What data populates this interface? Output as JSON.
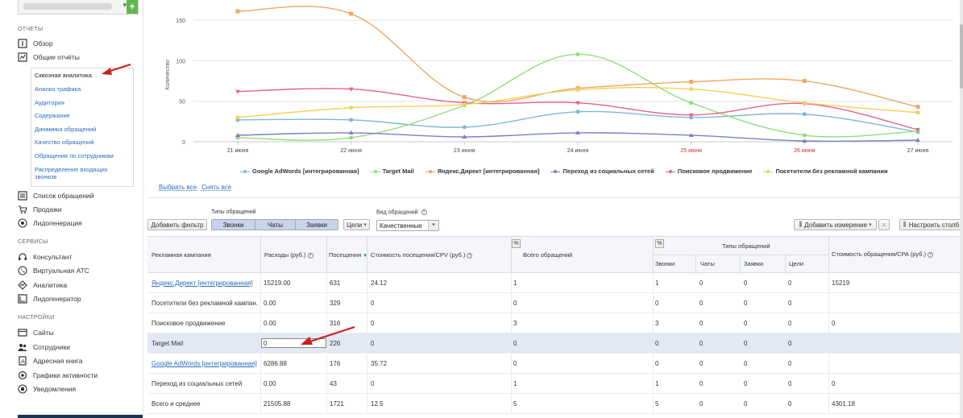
{
  "sidebar": {
    "sections": {
      "reports": "ОТЧЕТЫ",
      "services": "СЕРВИСЫ",
      "settings": "НАСТРОЙКИ"
    },
    "reports_items": [
      {
        "label": "Обзор",
        "icon": "info-icon"
      },
      {
        "label": "Общие отчёты",
        "icon": "chart-icon"
      }
    ],
    "submenu": [
      "Сквозная аналитика",
      "Анализ трафика",
      "Аудитория",
      "Содержание",
      "Динамика обращений",
      "Качество обращений",
      "Обращения по сотрудникам",
      "Распределение входящих звонков"
    ],
    "reports_items2": [
      {
        "label": "Список обращений",
        "icon": "list-icon"
      },
      {
        "label": "Продажи",
        "icon": "cart-icon"
      },
      {
        "label": "Лидогенерация",
        "icon": "target-icon"
      }
    ],
    "services_items": [
      {
        "label": "Консультант",
        "icon": "headset-icon"
      },
      {
        "label": "Виртуальная АТС",
        "icon": "phone-icon"
      },
      {
        "label": "Аналитика",
        "icon": "analytics-icon"
      },
      {
        "label": "Лидогенератор",
        "icon": "leadgen-icon"
      }
    ],
    "settings_items": [
      {
        "label": "Сайты",
        "icon": "sites-icon"
      },
      {
        "label": "Сотрудники",
        "icon": "users-icon"
      },
      {
        "label": "Адресная книга",
        "icon": "addressbook-icon"
      },
      {
        "label": "Графики активности",
        "icon": "activity-icon"
      },
      {
        "label": "Уведомления",
        "icon": "bell-icon"
      }
    ]
  },
  "chart_data": {
    "type": "line",
    "title": "",
    "xlabel": "",
    "ylabel": "Количество",
    "ylim": [
      0,
      165
    ],
    "yticks": [
      0,
      50,
      100,
      150
    ],
    "categories": [
      "21 июня",
      "22 июня",
      "23 июня",
      "24 июня",
      "25 июня",
      "26 июня",
      "27 июня"
    ],
    "weekend_categories": [
      "25 июня",
      "26 июня"
    ],
    "grid": true,
    "legend_position": "bottom",
    "series": [
      {
        "name": "Google AdWords [интегрированная]",
        "color": "#7eb6d9",
        "marker": "circle",
        "values": [
          27,
          27,
          18,
          37,
          30,
          34,
          12
        ]
      },
      {
        "name": "Target Mail",
        "color": "#8ee07a",
        "marker": "circle",
        "values": [
          5,
          5,
          45,
          108,
          48,
          8,
          13
        ]
      },
      {
        "name": "Яндекс.Директ [интегрированная]",
        "color": "#f0a765",
        "marker": "square",
        "values": [
          161,
          158,
          55,
          66,
          74,
          75,
          43
        ]
      },
      {
        "name": "Переход из социальных сетей",
        "color": "#7b7fc4",
        "marker": "triangle",
        "values": [
          8,
          11,
          6,
          11,
          8,
          1,
          2
        ]
      },
      {
        "name": "Поисковое продвижение",
        "color": "#e5638a",
        "marker": "triangle-down",
        "values": [
          62,
          65,
          48,
          48,
          33,
          47,
          15
        ]
      },
      {
        "name": "Посетители без рекламной кампании",
        "color": "#f2d05b",
        "marker": "circle",
        "values": [
          30,
          42,
          46,
          64,
          65,
          48,
          36
        ]
      }
    ]
  },
  "chart_links": {
    "select_all": "Выбрать все",
    "deselect_all": "Снять все"
  },
  "toolbar": {
    "add_filter": "Добавить фильтр",
    "types_label": "Типы обращений",
    "types": [
      "Звонки",
      "Чаты",
      "Заявки"
    ],
    "goals": "Цели",
    "view_label": "Вид обращений",
    "view_value": "Качественные",
    "add_dimension": "Добавить измерение",
    "configure": "Настроить столб"
  },
  "table": {
    "headers": {
      "campaign": "Рекламная кампания",
      "spend": "Расходы (руб.)",
      "visits": "Посещения",
      "cpv": "Стоимость посещения/CPV (руб.)",
      "total": "Всего обращений",
      "types": "Типы обращений",
      "calls": "Звонки",
      "chats": "Чаты",
      "requests": "Заявки",
      "goals": "Цели",
      "cpa": "Стоимость обращения/CPA (руб.)",
      "pct": "%"
    },
    "rows": [
      {
        "campaign": "Яндекс.Директ [интегрированная]",
        "link": true,
        "spend": "15219.00",
        "visits": "631",
        "cpv": "24.12",
        "total": "1",
        "calls": "1",
        "chats": "0",
        "requests": "0",
        "goals": "0",
        "cpa": "15219"
      },
      {
        "campaign": "Посетители без рекламной кампан...",
        "link": false,
        "spend": "0.00",
        "visits": "329",
        "cpv": "0",
        "total": "0",
        "calls": "0",
        "chats": "0",
        "requests": "0",
        "goals": "0",
        "cpa": ""
      },
      {
        "campaign": "Поисковое продвижение",
        "link": false,
        "spend": "0.00",
        "visits": "316",
        "cpv": "0",
        "total": "3",
        "calls": "3",
        "chats": "0",
        "requests": "0",
        "goals": "0",
        "cpa": "0"
      },
      {
        "campaign": "Target Mail",
        "link": false,
        "spend": "0",
        "visits": "226",
        "cpv": "0",
        "total": "0",
        "calls": "0",
        "chats": "0",
        "requests": "0",
        "goals": "0",
        "cpa": ""
      },
      {
        "campaign": "Google AdWords [интегрированная]",
        "link": true,
        "spend": "6286.88",
        "visits": "176",
        "cpv": "35.72",
        "total": "0",
        "calls": "0",
        "chats": "0",
        "requests": "0",
        "goals": "0",
        "cpa": ""
      },
      {
        "campaign": "Переход из социальных сетей",
        "link": false,
        "spend": "0.00",
        "visits": "43",
        "cpv": "0",
        "total": "1",
        "calls": "1",
        "chats": "0",
        "requests": "0",
        "goals": "0",
        "cpa": "0"
      },
      {
        "campaign": "Всего и среднее",
        "link": false,
        "spend": "21505.88",
        "visits": "1721",
        "cpv": "12.5",
        "total": "5",
        "calls": "5",
        "chats": "0",
        "requests": "0",
        "goals": "0",
        "cpa": "4301.18"
      }
    ]
  },
  "colors": {
    "accent": "#2a6ebb",
    "arrow": "#c8201e",
    "weekend": "#d22b2b"
  }
}
